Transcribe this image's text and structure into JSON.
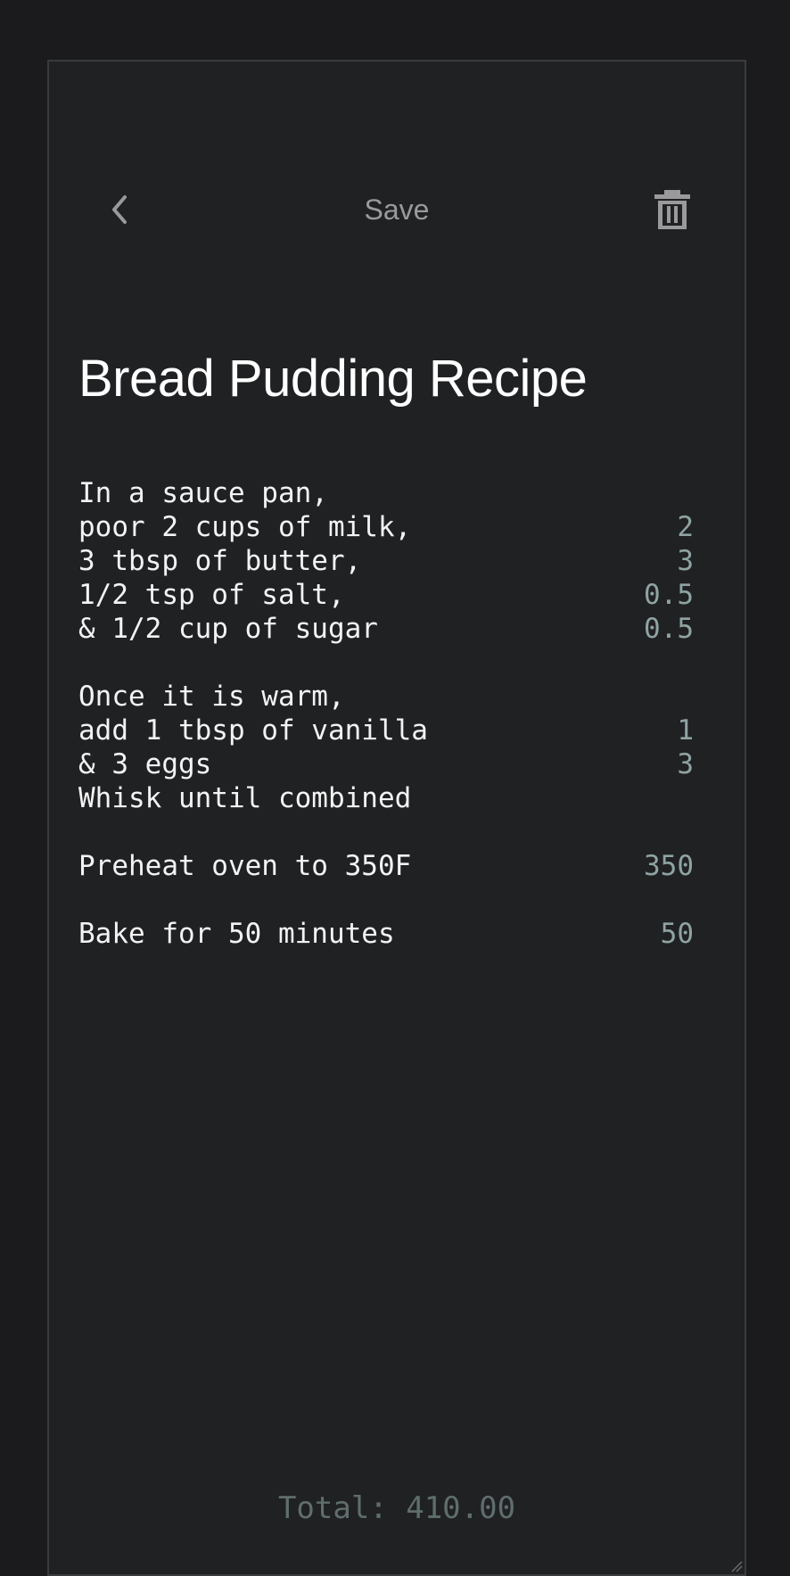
{
  "header": {
    "back_icon": "chevron-left-icon",
    "save_label": "Save",
    "delete_icon": "trash-icon",
    "icon_color": "#9a9a9c"
  },
  "note": {
    "title": "Bread Pudding Recipe",
    "lines": [
      {
        "text": "In a sauce pan,",
        "result": ""
      },
      {
        "text": "poor 2 cups of milk,",
        "result": "2"
      },
      {
        "text": "3 tbsp of butter,",
        "result": "3"
      },
      {
        "text": "1/2 tsp of salt,",
        "result": "0.5"
      },
      {
        "text": "& 1/2 cup of sugar",
        "result": "0.5"
      },
      {
        "text": "",
        "result": ""
      },
      {
        "text": "Once it is warm,",
        "result": ""
      },
      {
        "text": "add 1 tbsp of vanilla",
        "result": "1"
      },
      {
        "text": "& 3 eggs",
        "result": "3"
      },
      {
        "text": "Whisk until combined",
        "result": ""
      },
      {
        "text": "",
        "result": ""
      },
      {
        "text": "Preheat oven to 350F",
        "result": "350"
      },
      {
        "text": "",
        "result": ""
      },
      {
        "text": "Bake for 50 minutes",
        "result": "50"
      }
    ]
  },
  "footer": {
    "total_label": "Total: 410.00"
  },
  "colors": {
    "page_bg": "#1b1b1d",
    "card_bg": "#202123",
    "text": "#f3f3f3",
    "result": "#8fa3a3",
    "total": "#5f6d6d"
  }
}
